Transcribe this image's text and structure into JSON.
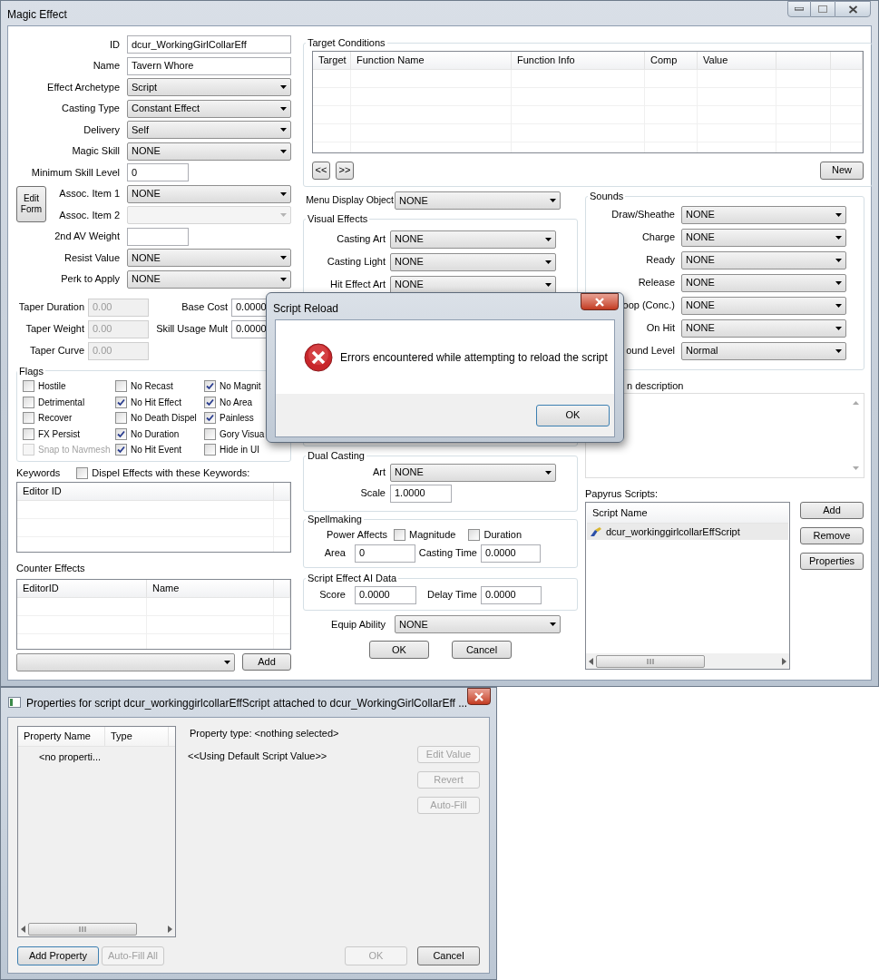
{
  "main_window": {
    "title": "Magic Effect",
    "fields": [
      {
        "label": "ID",
        "kind": "text",
        "value": "dcur_WorkingGirlCollarEff",
        "disabled": false
      },
      {
        "label": "Name",
        "kind": "text",
        "value": "Tavern Whore",
        "disabled": false
      },
      {
        "label": "Effect Archetype",
        "kind": "dropdown",
        "value": "Script",
        "disabled": false
      },
      {
        "label": "Casting Type",
        "kind": "dropdown",
        "value": "Constant Effect",
        "disabled": false
      },
      {
        "label": "Delivery",
        "kind": "dropdown",
        "value": "Self",
        "disabled": false
      },
      {
        "label": "Magic Skill",
        "kind": "dropdown",
        "value": "NONE",
        "disabled": false
      },
      {
        "label": "Minimum Skill Level",
        "kind": "short_text",
        "value": "0",
        "disabled": false
      }
    ],
    "edit_form_button": "Edit Form",
    "assoc_fields": [
      {
        "label": "Assoc. Item 1",
        "kind": "dropdown",
        "value": "NONE",
        "disabled": false
      },
      {
        "label": "Assoc. Item 2",
        "kind": "dropdown",
        "disabled": true
      }
    ],
    "more_fields": [
      {
        "label": "2nd AV Weight",
        "kind": "short_text",
        "disabled": false
      },
      {
        "label": "Resist Value",
        "kind": "dropdown",
        "value": "NONE",
        "disabled": false
      },
      {
        "label": "Perk to Apply",
        "kind": "dropdown",
        "value": "NONE",
        "disabled": false
      }
    ],
    "taper_fields": [
      {
        "label": "Taper Duration",
        "value": "0.00",
        "disabled": true
      },
      {
        "label": "Taper Weight",
        "value": "0.00",
        "disabled": true
      },
      {
        "label": "Taper Curve",
        "value": "0.00",
        "disabled": true
      }
    ],
    "cost_fields": [
      {
        "label": "Base Cost",
        "value": "0.0000",
        "disabled": false
      },
      {
        "label": "Skill Usage Mult",
        "value": "0.0000",
        "disabled": false
      }
    ],
    "flags": {
      "title": "Flags",
      "items": [
        {
          "label": "Hostile",
          "checked": false,
          "disabled": false
        },
        {
          "label": "No Recast",
          "checked": false,
          "disabled": false
        },
        {
          "label": "No Magnit",
          "checked": true,
          "disabled": false
        },
        {
          "label": "Detrimental",
          "checked": false,
          "disabled": false
        },
        {
          "label": "No Hit Effect",
          "checked": true,
          "disabled": false
        },
        {
          "label": "No Area",
          "checked": true,
          "disabled": false
        },
        {
          "label": "Recover",
          "checked": false,
          "disabled": false
        },
        {
          "label": "No Death Dispel",
          "checked": false,
          "disabled": false
        },
        {
          "label": "Painless",
          "checked": true,
          "disabled": false
        },
        {
          "label": "FX Persist",
          "checked": false,
          "disabled": false
        },
        {
          "label": "No Duration",
          "checked": true,
          "disabled": false
        },
        {
          "label": "Gory Visua",
          "checked": false,
          "disabled": false
        },
        {
          "label": "Snap to Navmesh",
          "checked": false,
          "disabled": true
        },
        {
          "label": "No Hit Event",
          "checked": true,
          "disabled": false
        },
        {
          "label": "Hide in UI",
          "checked": false,
          "disabled": false
        }
      ]
    },
    "keywords": {
      "title": "Keywords",
      "dispel_checkbox": {
        "label": "Dispel Effects with these Keywords:",
        "checked": false
      },
      "columns": [
        "Editor ID"
      ]
    },
    "counter_effects": {
      "title": "Counter Effects",
      "columns": [
        "EditorID",
        "Name"
      ],
      "add_button": "Add"
    },
    "target_conditions": {
      "title": "Target Conditions",
      "columns": [
        "Target",
        "Function Name",
        "Function Info",
        "Comp",
        "Value"
      ],
      "prev_button": "<<",
      "next_button": ">>",
      "new_button": "New"
    },
    "menu_display_object": {
      "label": "Menu Display Object",
      "value": "NONE"
    },
    "visual_effects": {
      "title": "Visual Effects",
      "fields": [
        {
          "label": "Casting Art",
          "value": "NONE"
        },
        {
          "label": "Casting Light",
          "value": "NONE"
        },
        {
          "label": "Hit Effect Art",
          "value": "NONE"
        }
      ]
    },
    "dual_casting": {
      "title": "Dual Casting",
      "art_label": "Art",
      "art_value": "NONE",
      "scale_label": "Scale",
      "scale_value": "1.0000"
    },
    "spellmaking": {
      "title": "Spellmaking",
      "power_affects_label": "Power Affects",
      "checkboxes": [
        {
          "label": "Magnitude",
          "checked": false
        },
        {
          "label": "Duration",
          "checked": false
        }
      ],
      "area_label": "Area",
      "area_value": "0",
      "casting_time_label": "Casting Time",
      "casting_time_value": "0.0000"
    },
    "script_effect_ai_data": {
      "title": "Script Effect AI Data",
      "score_label": "Score",
      "score_value": "0.0000",
      "delay_label": "Delay Time",
      "delay_value": "0.0000"
    },
    "equip_ability": {
      "label": "Equip Ability",
      "value": "NONE"
    },
    "buttons": [
      "OK",
      "Cancel"
    ],
    "sounds": {
      "title": "Sounds",
      "fields": [
        {
          "label": "Draw/Sheathe",
          "value": "NONE"
        },
        {
          "label": "Charge",
          "value": "NONE"
        },
        {
          "label": "Ready",
          "value": "NONE"
        },
        {
          "label": "Release",
          "value": "NONE"
        },
        {
          "label": "oop (Conc.)",
          "value": "NONE"
        },
        {
          "label": "On Hit",
          "value": "NONE"
        },
        {
          "label": "ound Level",
          "value": "Normal"
        }
      ]
    },
    "menu_description": {
      "label": "n description"
    },
    "papyrus_scripts": {
      "label": "Papyrus Scripts:",
      "columns": [
        "Script Name"
      ],
      "rows": [
        {
          "name": "dcur_workinggirlcollarEffScript",
          "selected": true
        }
      ],
      "buttons": [
        "Add",
        "Remove",
        "Properties"
      ]
    }
  },
  "error_dialog": {
    "title": "Script Reload",
    "message": "Errors encountered while attempting to reload the script",
    "button": "OK"
  },
  "properties_dialog": {
    "title": "Properties for script dcur_workinggirlcollarEffScript attached to dcur_WorkingGirlCollarEff ...",
    "columns": [
      "Property Name",
      "Type"
    ],
    "empty_text": "<no properti...",
    "property_type": "Property type: <nothing selected>",
    "default_value": "<<Using Default Script Value>>",
    "side_buttons": [
      {
        "label": "Edit Value",
        "disabled": true
      },
      {
        "label": "Revert",
        "disabled": true
      },
      {
        "label": "Auto-Fill",
        "disabled": true
      }
    ],
    "bottom_buttons": [
      {
        "label": "Add Property",
        "disabled": false,
        "focused": true
      },
      {
        "label": "Auto-Fill All",
        "disabled": true,
        "focused": false
      },
      {
        "label": "OK",
        "disabled": true,
        "focused": false
      },
      {
        "label": "Cancel",
        "disabled": false,
        "focused": false
      }
    ]
  }
}
